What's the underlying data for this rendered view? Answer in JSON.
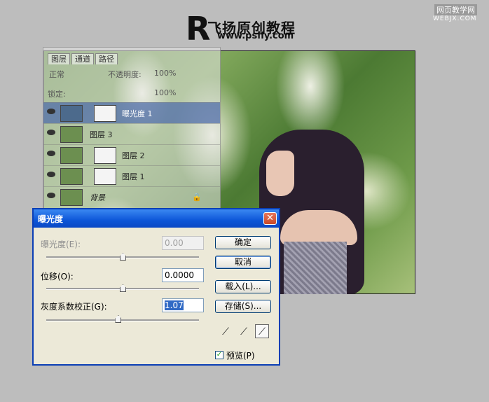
{
  "header": {
    "logo_letter": "R",
    "site_title": "飞扬原创教程",
    "site_url": "www.psfly.com",
    "watermark_top": "网页教学网",
    "watermark_bottom": "WEBJX.COM"
  },
  "layers_panel": {
    "tabs": [
      "图层",
      "通道",
      "路径"
    ],
    "blend_mode": "正常",
    "opacity_label": "不透明度:",
    "opacity_value": "100%",
    "lock_label": "锁定:",
    "fill_value": "100%",
    "layers": [
      {
        "name": "曝光度 1",
        "selected": true
      },
      {
        "name": "图层 3",
        "selected": false
      },
      {
        "name": "图层 2",
        "selected": false
      },
      {
        "name": "图层 1",
        "selected": false
      },
      {
        "name": "背景",
        "selected": false
      }
    ]
  },
  "dialog": {
    "title": "曝光度",
    "close_icon": "close-icon",
    "exposure_label": "曝光度(E):",
    "exposure_value": "0.00",
    "offset_label": "位移(O):",
    "offset_value": "0.0000",
    "gamma_label": "灰度系数校正(G):",
    "gamma_value": "1.07",
    "ok_label": "确定",
    "cancel_label": "取消",
    "load_label": "载入(L)...",
    "save_label": "存储(S)...",
    "preview_label": "预览(P)",
    "preview_checked": true,
    "sliders": {
      "exposure": 0.5,
      "offset": 0.5,
      "gamma": 0.47
    }
  },
  "colors": {
    "titlebar": "#0d56d8",
    "dialog_bg": "#ece9d8",
    "selected_layer": "#506eaa",
    "canvas_bg": "#bdbdbd"
  }
}
